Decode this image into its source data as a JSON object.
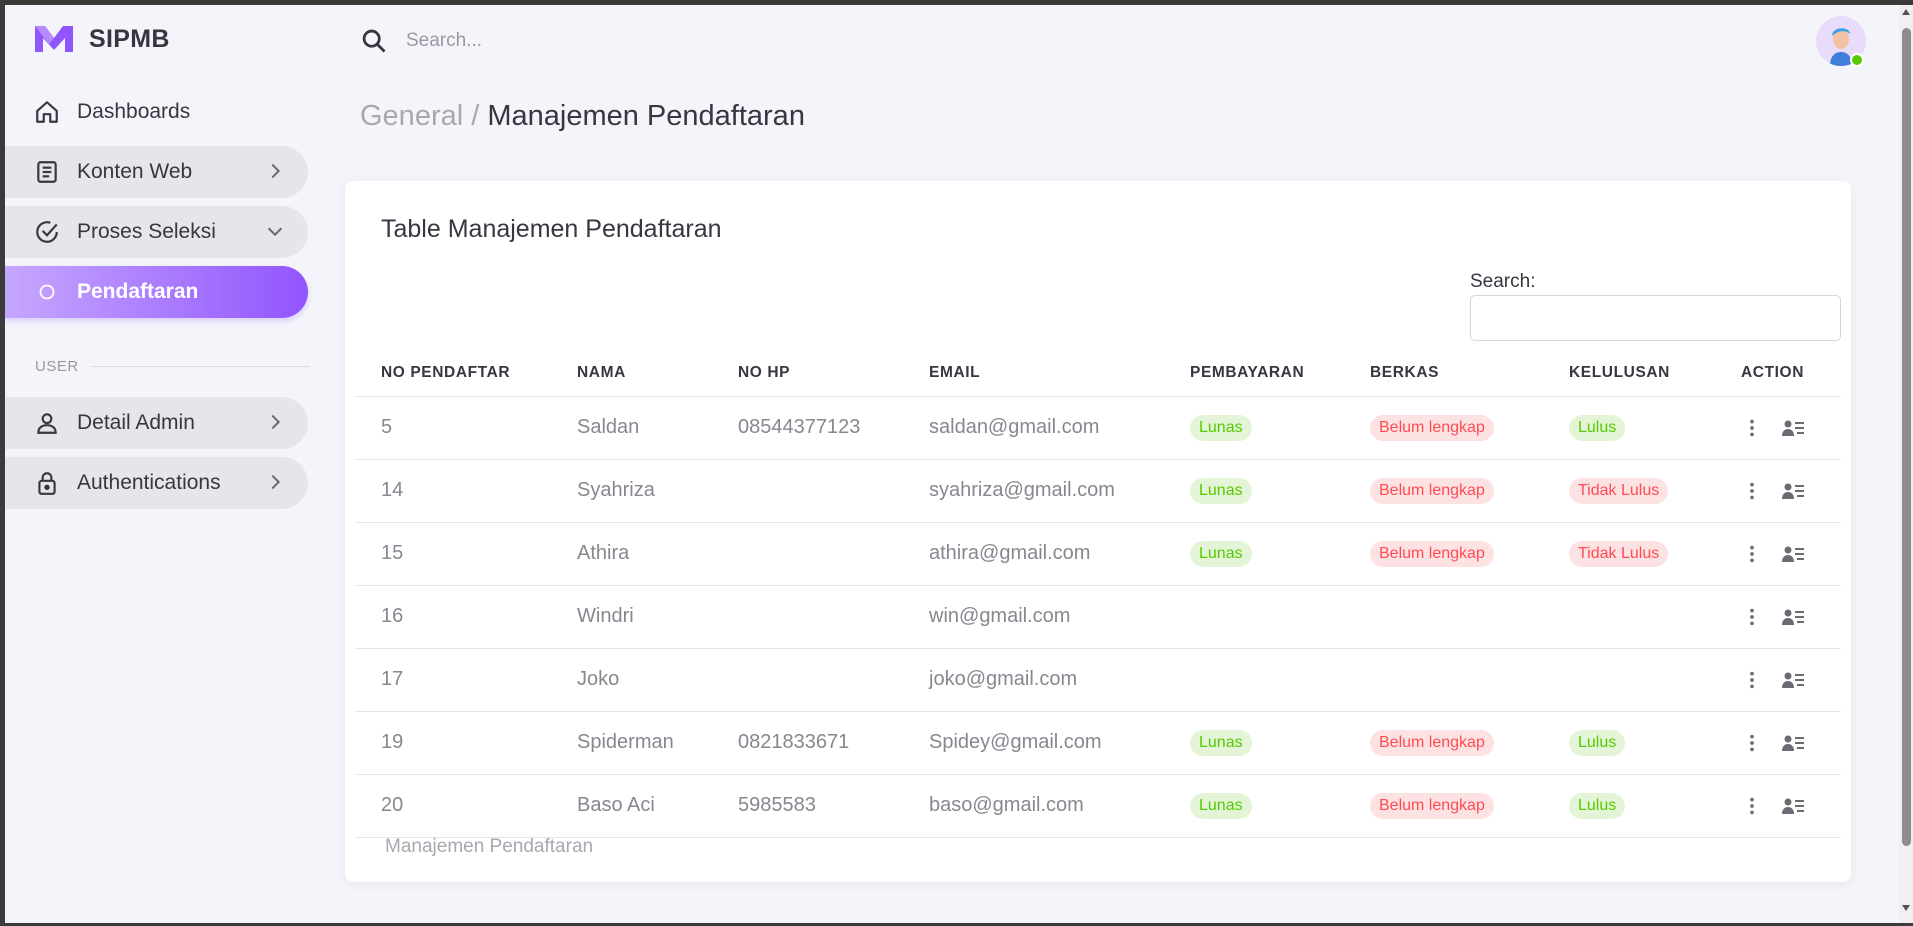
{
  "brand": {
    "name": "SIPMB"
  },
  "topbar": {
    "search_placeholder": "Search..."
  },
  "sidebar": {
    "items": [
      {
        "label": "Dashboards",
        "icon": "home-icon"
      },
      {
        "label": "Konten Web",
        "icon": "document-icon"
      },
      {
        "label": "Proses Seleksi",
        "icon": "check-circle-icon"
      },
      {
        "label": "Pendaftaran",
        "icon": "circle-icon"
      },
      {
        "label": "Detail Admin",
        "icon": "user-icon"
      },
      {
        "label": "Authentications",
        "icon": "lock-icon"
      }
    ],
    "section_user": "USER"
  },
  "breadcrumb": {
    "parent": "General",
    "separator": " / ",
    "current": "Manajemen Pendaftaran"
  },
  "card": {
    "title": "Table Manajemen Pendaftaran",
    "search_label": "Search:",
    "footer": "Manajemen Pendaftaran"
  },
  "table": {
    "headers": [
      "NO PENDAFTAR",
      "NAMA",
      "NO HP",
      "EMAIL",
      "PEMBAYARAN",
      "BERKAS",
      "KELULUSAN",
      "ACTION"
    ],
    "rows": [
      {
        "no": "5",
        "nama": "Saldan",
        "hp": "08544377123",
        "email": "saldan@gmail.com",
        "pembayaran": "Lunas",
        "berkas": "Belum lengkap",
        "kelulusan": "Lulus"
      },
      {
        "no": "14",
        "nama": "Syahriza",
        "hp": "",
        "email": "syahriza@gmail.com",
        "pembayaran": "Lunas",
        "berkas": "Belum lengkap",
        "kelulusan": "Tidak Lulus"
      },
      {
        "no": "15",
        "nama": "Athira",
        "hp": "",
        "email": "athira@gmail.com",
        "pembayaran": "Lunas",
        "berkas": "Belum lengkap",
        "kelulusan": "Tidak Lulus"
      },
      {
        "no": "16",
        "nama": "Windri",
        "hp": "",
        "email": "win@gmail.com",
        "pembayaran": "",
        "berkas": "",
        "kelulusan": ""
      },
      {
        "no": "17",
        "nama": "Joko",
        "hp": "",
        "email": "joko@gmail.com",
        "pembayaran": "",
        "berkas": "",
        "kelulusan": ""
      },
      {
        "no": "19",
        "nama": "Spiderman",
        "hp": "0821833671",
        "email": "Spidey@gmail.com",
        "pembayaran": "Lunas",
        "berkas": "Belum lengkap",
        "kelulusan": "Lulus"
      },
      {
        "no": "20",
        "nama": "Baso Aci",
        "hp": "5985583",
        "email": "baso@gmail.com",
        "pembayaran": "Lunas",
        "berkas": "Belum lengkap",
        "kelulusan": "Lulus"
      }
    ]
  },
  "colors": {
    "accent": "#9155fd",
    "success": "#56ca00",
    "error": "#ff4c51"
  }
}
